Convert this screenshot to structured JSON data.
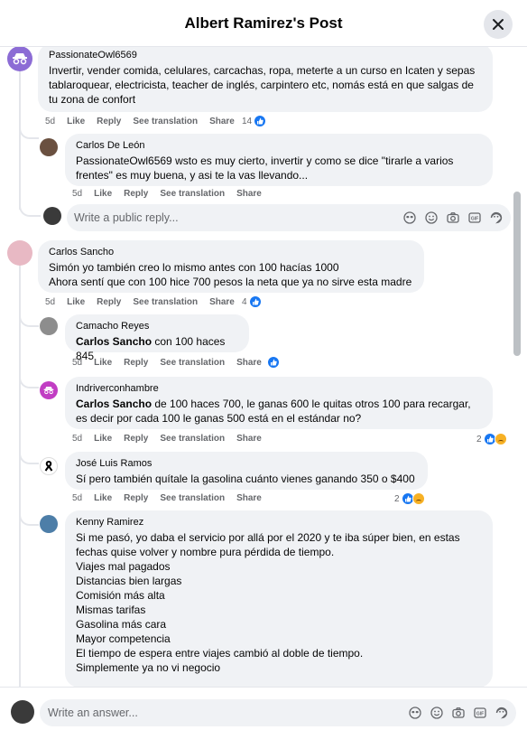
{
  "header": {
    "title": "Albert Ramirez's Post"
  },
  "comments": [
    {
      "author": "PassionateOwl6569",
      "text": "Invertir, vender comida, celulares, carcachas, ropa, meterte a un curso en Icaten y sepas tablaroquear, electricista, teacher de inglés, carpintero etc, nomás está en que salgas de tu zona de confort",
      "time": "5d",
      "like": "Like",
      "reply": "Reply",
      "see_translation": "See translation",
      "share": "Share",
      "reactions": "14"
    },
    {
      "author": "Carlos De León",
      "text": "PassionateOwl6569 wsto es muy cierto, invertir y como se dice \"tirarle a varios frentes\" es muy buena, y asi te la vas llevando...",
      "time": "5d",
      "like": "Like",
      "reply": "Reply",
      "see_translation": "See translation",
      "share": "Share"
    },
    {
      "author": "Carlos Sancho",
      "text_line1": "Simón yo también creo lo mismo antes con 100 hacías 1000",
      "text_line2": "Ahora sentí que con 100 hice 700 pesos la neta que ya no sirve esta madre",
      "time": "5d",
      "like": "Like",
      "reply": "Reply",
      "see_translation": "See translation",
      "share": "Share",
      "reactions": "4"
    },
    {
      "author": "Camacho Reyes",
      "mention": "Carlos Sancho",
      "text": " con 100 haces 845",
      "time": "5d",
      "like": "Like",
      "reply": "Reply",
      "see_translation": "See translation",
      "share": "Share"
    },
    {
      "author": "Indriverconhambre",
      "mention": "Carlos Sancho",
      "text": " de 100 haces 700, le ganas 600 le quitas otros 100 para recargar, es decir por cada 100 le ganas 500 está en el estándar no?",
      "time": "5d",
      "like": "Like",
      "reply": "Reply",
      "see_translation": "See translation",
      "share": "Share",
      "reactions": "2"
    },
    {
      "author": "José Luis Ramos",
      "text": "Sí pero también quítale la gasolina cuánto vienes ganando 350 o $400",
      "time": "5d",
      "like": "Like",
      "reply": "Reply",
      "see_translation": "See translation",
      "share": "Share",
      "reactions": "2"
    },
    {
      "author": "Kenny Ramirez",
      "lines": [
        "Si me pasó, yo daba el servicio por allá por el 2020 y te iba súper bien, en estas fechas quise volver y nombre pura pérdida de tiempo.",
        "Viajes mal pagados",
        "Distancias bien largas",
        "Comisión más alta",
        "Mismas tarifas",
        "Gasolina más cara",
        "Mayor competencia",
        "El tiempo de espera entre viajes cambió al doble de tiempo.",
        "Simplemente ya no vi negocio"
      ]
    }
  ],
  "reply_box": {
    "placeholder": "Write a public reply..."
  },
  "footer": {
    "placeholder": "Write an answer..."
  },
  "icons": {
    "close": "close-icon",
    "like": "like-icon",
    "sad": "sad-icon",
    "sticker": "sticker-icon",
    "emoji": "emoji-icon",
    "camera": "camera-icon",
    "gif": "gif-icon",
    "avatar_sticker": "avatar-sticker-icon"
  },
  "colors": {
    "accent": "#1877f2",
    "bubble": "#f0f2f5",
    "muted": "#65676b"
  }
}
